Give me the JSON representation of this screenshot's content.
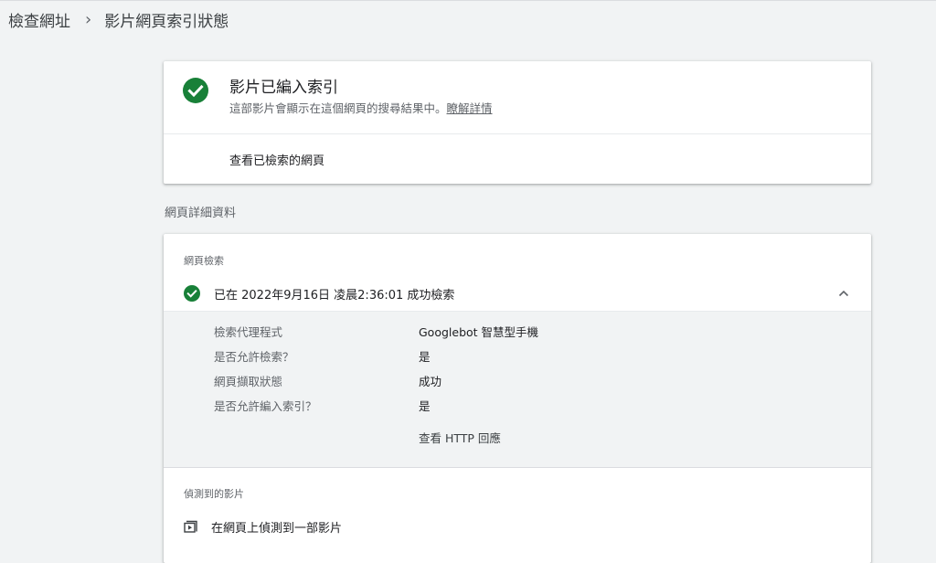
{
  "breadcrumb": {
    "parent": "檢查網址",
    "separator": "›",
    "current": "影片網頁索引狀態"
  },
  "status_card": {
    "title": "影片已編入索引",
    "description": "這部影片會顯示在這個網頁的搜尋結果中。",
    "learn_more": "瞭解詳情",
    "view_crawled": "查看已檢索的網頁",
    "status_icon": "check-circle-icon",
    "status_color": "#188038"
  },
  "section_heading": "網頁詳細資料",
  "details_card": {
    "crawl_heading": "網頁檢索",
    "crawl_status": "已在 2022年9月16日 凌晨2:36:01 成功檢索",
    "crawl_icon": "check-circle-icon",
    "expand_icon": "chevron-up-icon",
    "rows": [
      {
        "label": "檢索代理程式",
        "value": "Googlebot 智慧型手機"
      },
      {
        "label": "是否允許檢索？",
        "value": "是"
      },
      {
        "label": "網頁擷取狀態",
        "value": "成功"
      },
      {
        "label": "是否允許編入索引？",
        "value": "是"
      }
    ],
    "http_link": "查看 HTTP 回應",
    "video_heading": "偵測到的影片",
    "video_text": "在網頁上偵測到一部影片",
    "video_icon": "video-icon"
  }
}
